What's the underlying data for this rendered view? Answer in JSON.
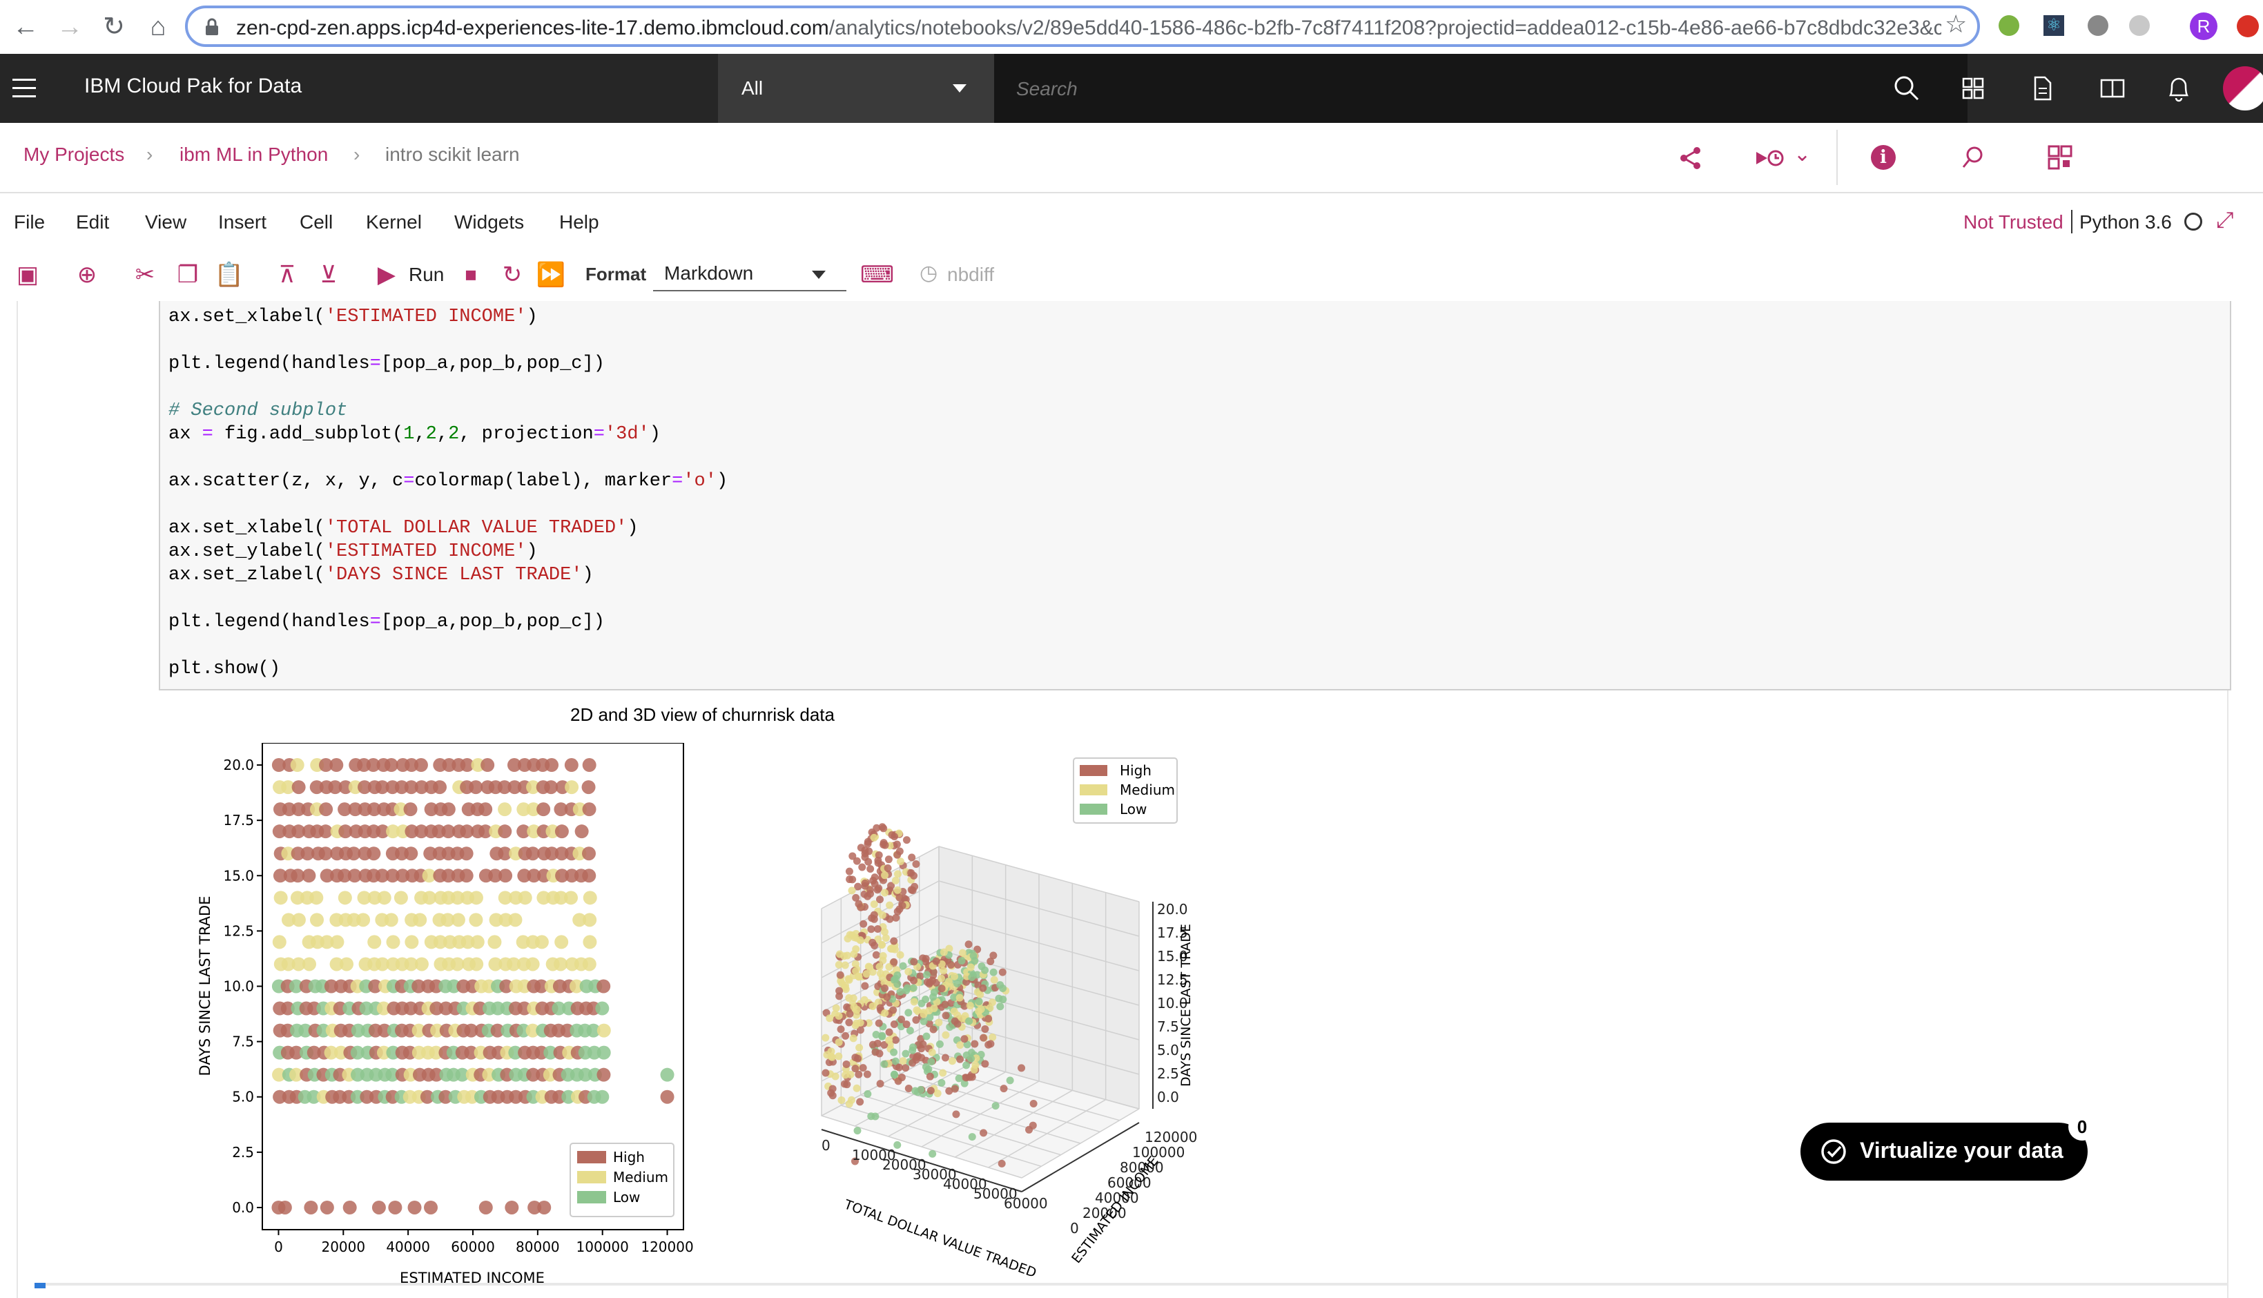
{
  "browser": {
    "url_host": "zen-cpd-zen.apps.icp4d-experiences-lite-17.demo.ibmcloud.com",
    "url_path": "/analytics/notebooks/v2/89e5dd40-1586-486c-b2fb-7c8f7411f208?projectid=addea012-c15b-4e86-ae66-b7c8dbdc32e3&c...",
    "profile_initial": "R"
  },
  "topbar": {
    "title": "IBM Cloud Pak for Data",
    "scope": "All",
    "search_placeholder": "Search"
  },
  "breadcrumb": {
    "items": [
      "My Projects",
      "ibm ML in Python",
      "intro scikit learn"
    ]
  },
  "menu": {
    "items": [
      "File",
      "Edit",
      "View",
      "Insert",
      "Cell",
      "Kernel",
      "Widgets",
      "Help"
    ],
    "trust": "Not Trusted",
    "kernel": "Python 3.6"
  },
  "toolbar": {
    "run_label": "Run",
    "format_label": "Format",
    "format_value": "Markdown",
    "nbdiff_label": "nbdiff"
  },
  "code": {
    "lines": [
      [
        "ax.set_xlabel(",
        "'ESTIMATED INCOME'",
        ")"
      ],
      [
        "plt.legend(handles",
        "=",
        "[pop_a,pop_b,pop_c])"
      ],
      [
        "# Second subplot"
      ],
      [
        "ax ",
        "=",
        " fig.add_subplot(",
        "1",
        ",",
        "2",
        ",",
        "2",
        ", projection",
        "=",
        "'3d'",
        ")"
      ],
      [
        "ax.scatter(z, x, y, c",
        "=",
        "colormap(label), marker",
        "=",
        "'o'",
        ")"
      ],
      [
        "ax.set_xlabel(",
        "'TOTAL DOLLAR VALUE TRADED'",
        ")"
      ],
      [
        "ax.set_ylabel(",
        "'ESTIMATED INCOME'",
        ")"
      ],
      [
        "ax.set_zlabel(",
        "'DAYS SINCE LAST TRADE'",
        ")"
      ],
      [
        "plt.legend(handles",
        "=",
        "[pop_a,pop_b,pop_c])"
      ],
      [
        "plt.show()"
      ]
    ]
  },
  "figure": {
    "title": "2D and 3D view of churnrisk data"
  },
  "chart_data": [
    {
      "type": "scatter",
      "title": "",
      "xlabel": "ESTIMATED INCOME",
      "ylabel": "DAYS SINCE LAST TRADE",
      "xlim": [
        -5000,
        125000
      ],
      "ylim": [
        -1,
        21
      ],
      "x_ticks": [
        "0",
        "20000",
        "40000",
        "60000",
        "80000",
        "100000",
        "120000"
      ],
      "y_ticks": [
        "0.0",
        "2.5",
        "5.0",
        "7.5",
        "10.0",
        "12.5",
        "15.0",
        "17.5",
        "20.0"
      ],
      "legend": [
        "High",
        "Medium",
        "Low"
      ],
      "legend_position": "lower right",
      "colors": {
        "High": "#b56a5d",
        "Medium": "#e6dc8c",
        "Low": "#8dc58f"
      },
      "series": [
        {
          "name": "High",
          "description_rows": [
            0,
            5,
            6,
            7,
            8,
            9,
            10,
            15,
            16,
            17,
            18,
            19,
            20
          ],
          "x_range": [
            0,
            100000
          ]
        },
        {
          "name": "Medium",
          "description_rows": [
            5,
            10,
            11,
            12,
            13,
            14,
            15,
            16,
            17,
            18,
            19,
            20
          ],
          "x_range": [
            0,
            100000
          ]
        },
        {
          "name": "Low",
          "description_rows": [
            5,
            6,
            7,
            8,
            9,
            10,
            0
          ],
          "x_range": [
            0,
            120000
          ]
        }
      ]
    },
    {
      "type": "scatter",
      "title": "",
      "projection": "3d",
      "xlabel": "TOTAL DOLLAR VALUE TRADED",
      "ylabel": "ESTIMATED INCOME",
      "zlabel": "DAYS SINCE LAST TRADE",
      "x_ticks": [
        "0",
        "10000",
        "20000",
        "30000",
        "40000",
        "50000",
        "60000"
      ],
      "y_ticks": [
        "0",
        "20000",
        "40000",
        "60000",
        "80000",
        "100000",
        "120000"
      ],
      "z_ticks": [
        "0.0",
        "2.5",
        "5.0",
        "7.5",
        "10.0",
        "12.5",
        "15.0",
        "17.5",
        "20.0"
      ],
      "legend": [
        "High",
        "Medium",
        "Low"
      ],
      "legend_position": "top"
    }
  ],
  "virtualize": {
    "label": "Virtualize your data",
    "count": "0"
  }
}
